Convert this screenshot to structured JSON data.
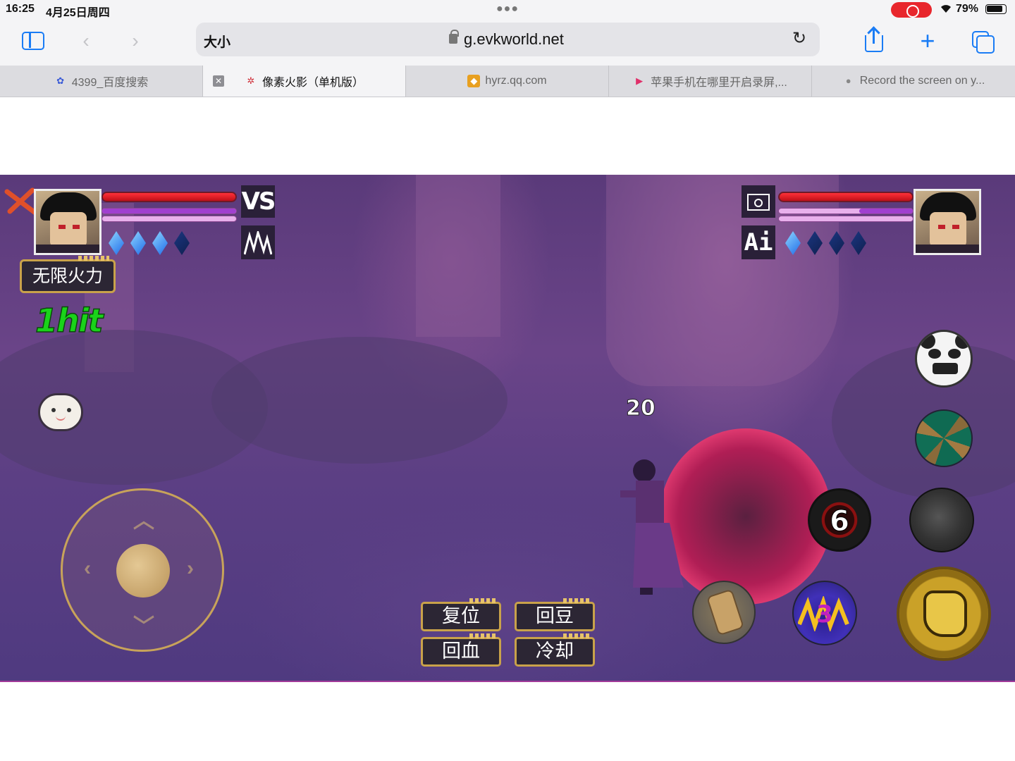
{
  "status_bar": {
    "time": "16:25",
    "date": "4月25日周四",
    "battery": "79%",
    "icons": [
      "screen-recording-icon",
      "wifi-icon",
      "battery-icon"
    ]
  },
  "browser": {
    "text_size_label": "大小",
    "url_host": "g.evkworld.net",
    "accent_color": "#1a7cf5",
    "tabs": [
      {
        "label": "4399_百度搜索",
        "favicon": "baidu-paw-icon",
        "active": false
      },
      {
        "label": "像素火影（单机版）",
        "favicon": "shuriken-icon",
        "active": true
      },
      {
        "label": "hyrz.qq.com",
        "favicon": "naruto-favicon",
        "active": false
      },
      {
        "label": "苹果手机在哪里开启录屏,...",
        "favicon": "play-favicon",
        "active": false
      },
      {
        "label": "Record the screen on y...",
        "favicon": "apple-icon",
        "active": false
      }
    ]
  },
  "game": {
    "vs_label": "VS",
    "ai_label": "Ai",
    "mode_button": "无限火力",
    "combo_text": "1hit",
    "damage_number": "20",
    "player1": {
      "hp_ratio": 1.0,
      "chakra_ratio": 1.0,
      "gems_full": 3,
      "gems_total": 4
    },
    "player2": {
      "hp_ratio": 1.0,
      "chakra_ratio": 0.4,
      "gems_full": 1,
      "gems_total": 4
    },
    "cheat_buttons": {
      "reset": "复位",
      "refill_beans": "回豆",
      "heal": "回血",
      "cooldown": "冷却"
    },
    "skills": {
      "sharingan_cooldown": "6",
      "wave_cooldown": "3"
    }
  }
}
